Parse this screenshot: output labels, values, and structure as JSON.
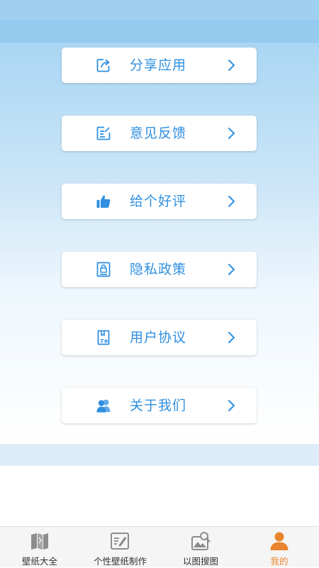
{
  "colors": {
    "accent": "#2f8fe0",
    "active_tab": "#e8852e",
    "tab_icon": "#8c8c8c"
  },
  "menu": {
    "items": [
      {
        "label": "分享应用",
        "icon": "share-icon"
      },
      {
        "label": "意见反馈",
        "icon": "feedback-icon"
      },
      {
        "label": "给个好评",
        "icon": "thumbs-up-icon"
      },
      {
        "label": "隐私政策",
        "icon": "privacy-lock-icon"
      },
      {
        "label": "用户协议",
        "icon": "agreement-document-icon"
      },
      {
        "label": "关于我们",
        "icon": "users-icon"
      }
    ]
  },
  "tabbar": {
    "tabs": [
      {
        "label": "壁纸大全",
        "icon": "wallpaper-book-icon",
        "active": false
      },
      {
        "label": "个性壁纸制作",
        "icon": "edit-image-icon",
        "active": false
      },
      {
        "label": "以图搜图",
        "icon": "image-search-icon",
        "active": false
      },
      {
        "label": "我的",
        "icon": "person-icon",
        "active": true
      }
    ]
  }
}
